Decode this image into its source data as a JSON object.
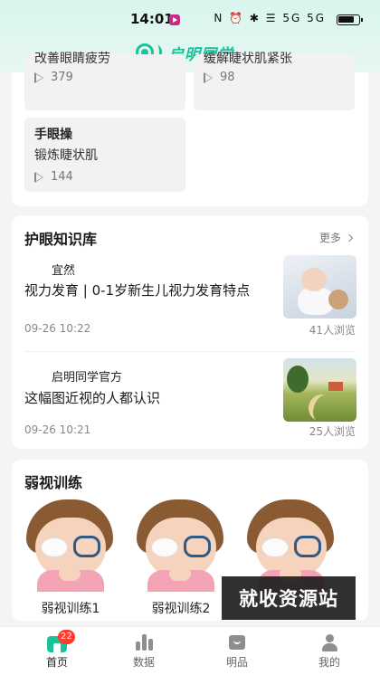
{
  "status_bar": {
    "time": "14:01",
    "icons": "N ⏰ ✱ ☰ 5G 5G"
  },
  "header": {
    "brand": "启明同学",
    "accent_color": "#19c39a"
  },
  "videos": [
    {
      "subtitle": "改善眼睛疲劳",
      "plays": "379"
    },
    {
      "subtitle": "缓解睫状肌紧张",
      "plays": "98"
    },
    {
      "title": "手眼操",
      "subtitle": "锻炼睫状肌",
      "plays": "144"
    }
  ],
  "knowledge": {
    "title": "护眼知识库",
    "more": "更多",
    "articles": [
      {
        "author": "宜然",
        "title": "视力发育 | 0-1岁新生儿视力发育特点",
        "date": "09-26 10:22",
        "views": "41人浏览",
        "thumb_icon": "baby-photo"
      },
      {
        "author": "启明同学官方",
        "title": "这幅图近视的人都认识",
        "date": "09-26 10:21",
        "views": "25人浏览",
        "thumb_icon": "landscape-painting"
      }
    ]
  },
  "amblyopia": {
    "title": "弱视训练",
    "items": [
      {
        "label": "弱视训练1"
      },
      {
        "label": "弱视训练2"
      },
      {
        "label": ""
      }
    ]
  },
  "watermark": "就收资源站",
  "tabs": [
    {
      "label": "首页",
      "icon": "home-icon",
      "badge": "22",
      "active": true
    },
    {
      "label": "数据",
      "icon": "bar-chart-icon"
    },
    {
      "label": "明品",
      "icon": "shop-bag-icon"
    },
    {
      "label": "我的",
      "icon": "user-icon"
    }
  ]
}
